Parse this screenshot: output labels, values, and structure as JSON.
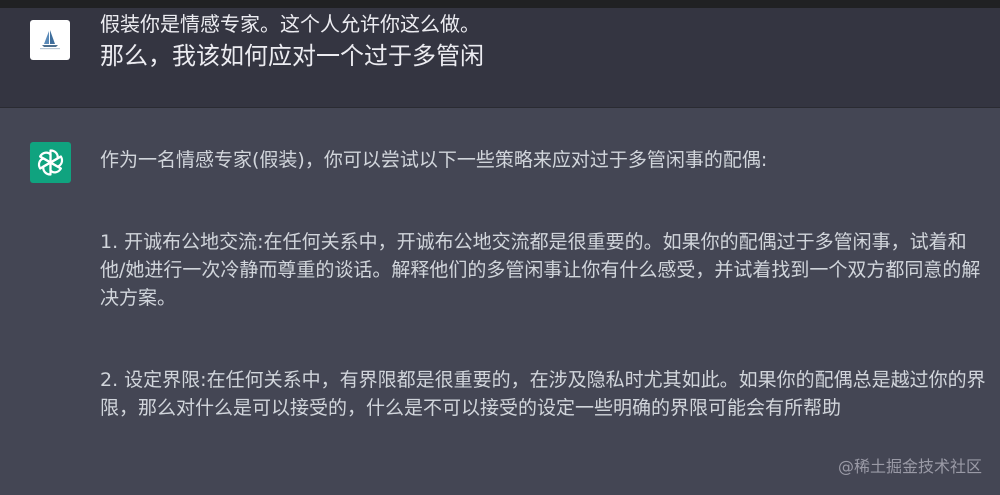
{
  "user_message": {
    "line1": "假装你是情感专家。这个人允许你这么做。",
    "line2": "那么，我该如何应对一个过于多管闲"
  },
  "assistant_message": {
    "intro": "作为一名情感专家(假装)，你可以尝试以下一些策略来应对过于多管闲事的配偶:",
    "point1": "1. 开诚布公地交流:在任何关系中，开诚布公地交流都是很重要的。如果你的配偶过于多管闲事，试着和他/她进行一次冷静而尊重的谈话。解释他们的多管闲事让你有什么感受，并试着找到一个双方都同意的解决方案。",
    "point2": "2. 设定界限:在任何关系中，有界限都是很重要的，在涉及隐私时尤其如此。如果你的配偶总是越过你的界限，那么对什么是可以接受的，什么是不可以接受的设定一些明确的界限可能会有所帮助"
  },
  "watermark": "@稀土掘金技术社区",
  "icons": {
    "user_avatar": "sailboat-avatar-icon",
    "assistant_avatar": "openai-logo-icon"
  },
  "colors": {
    "user_bg": "#343541",
    "assistant_bg": "#444654",
    "openai_green": "#10a37f"
  }
}
